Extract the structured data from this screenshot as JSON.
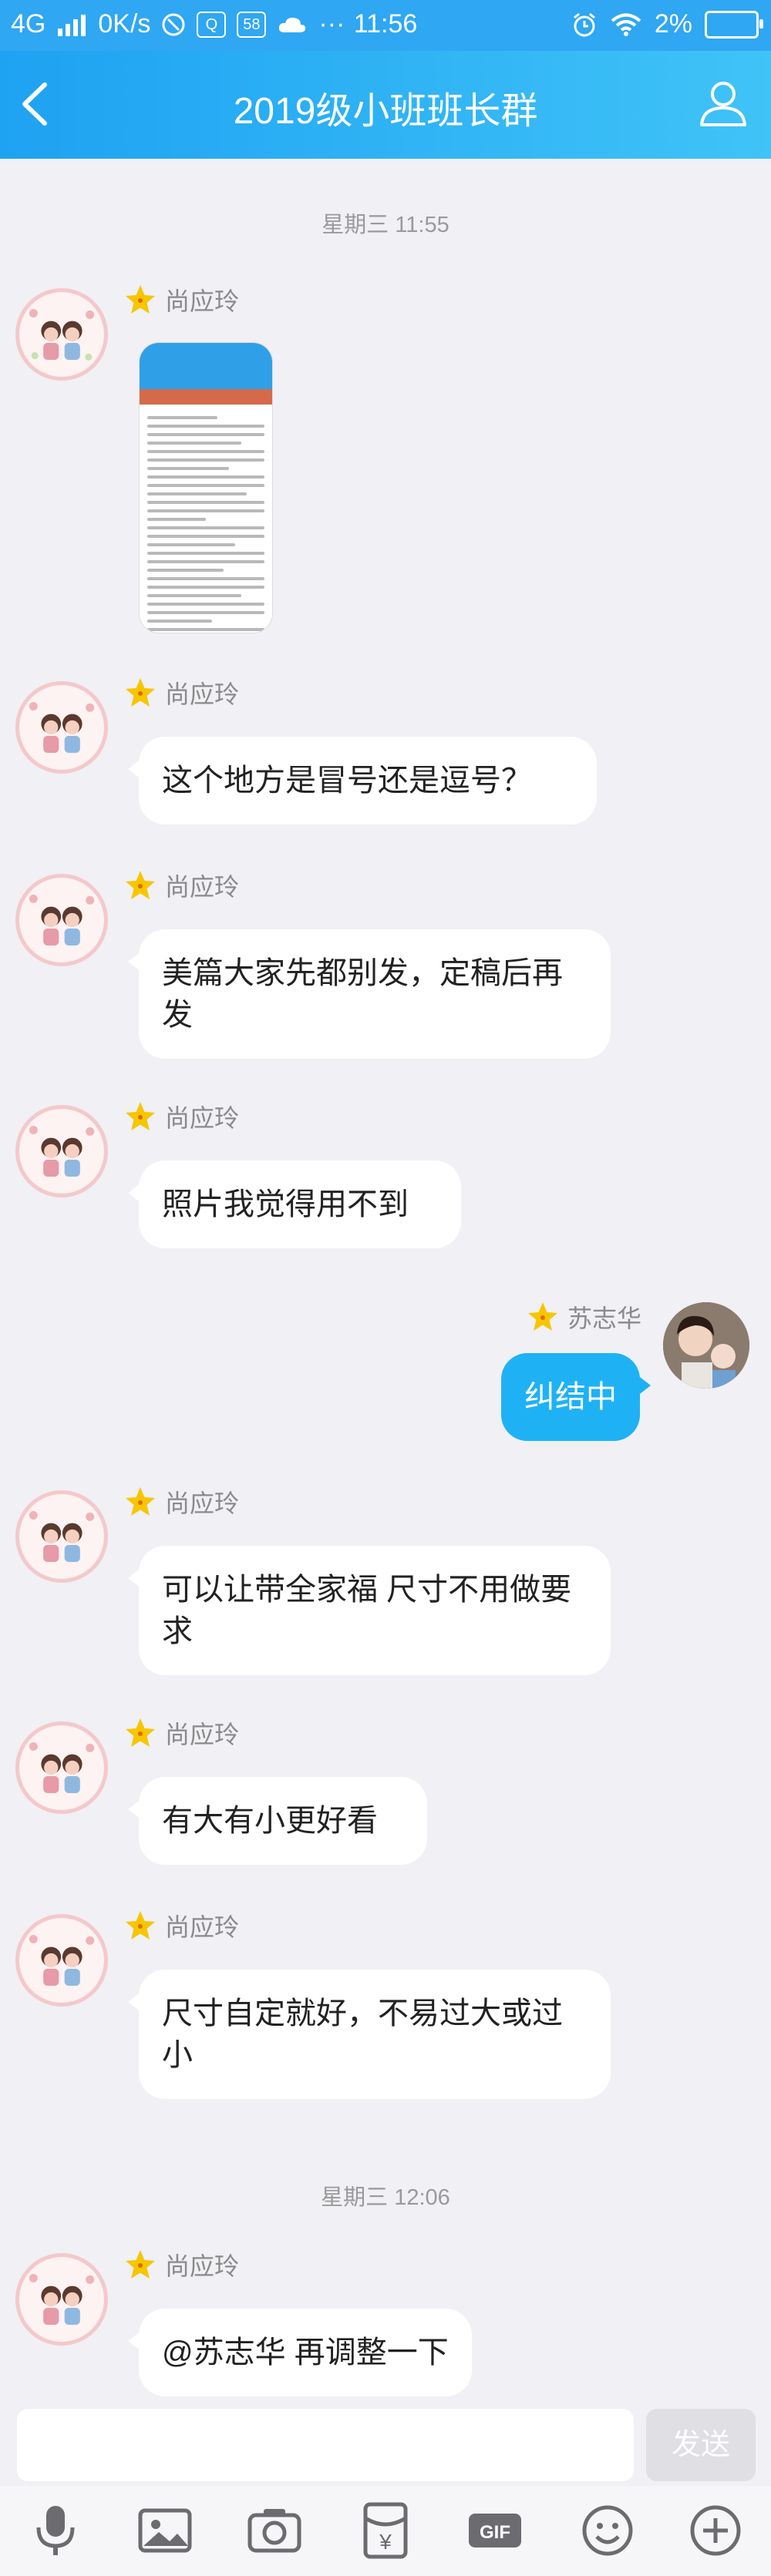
{
  "status_bar": {
    "network": "4G",
    "speed": "0K/s",
    "badge": "58",
    "more": "···",
    "time": "11:56",
    "battery": "2%"
  },
  "header": {
    "title": "2019级小班班长群"
  },
  "messages": [
    {
      "type": "time",
      "text": "星期三 11:55"
    },
    {
      "type": "image",
      "sender": "尚应玲"
    },
    {
      "type": "text",
      "sender": "尚应玲",
      "text": "这个地方是冒号还是逗号？"
    },
    {
      "type": "text",
      "sender": "尚应玲",
      "text": "美篇大家先都别发，定稿后再发"
    },
    {
      "type": "text",
      "sender": "尚应玲",
      "text": "照片我觉得用不到"
    },
    {
      "type": "text",
      "sender": "苏志华",
      "text": "纠结中",
      "self": true
    },
    {
      "type": "text",
      "sender": "尚应玲",
      "text": "可以让带全家福 尺寸不用做要求"
    },
    {
      "type": "text",
      "sender": "尚应玲",
      "text": "有大有小更好看"
    },
    {
      "type": "text",
      "sender": "尚应玲",
      "text": "尺寸自定就好，不易过大或过小"
    },
    {
      "type": "time",
      "text": "星期三 12:06"
    },
    {
      "type": "text",
      "sender": "尚应玲",
      "text": "@苏志华 再调整一下"
    }
  ],
  "input": {
    "value": "",
    "send_label": "发送"
  },
  "toolbar": {
    "items": [
      "mic-icon",
      "picture-icon",
      "camera-icon",
      "red-packet-icon",
      "gif-icon",
      "emoji-icon",
      "plus-icon"
    ],
    "red_packet_symbol": "¥",
    "gif_label": "GIF"
  },
  "colors": {
    "accent": "#1eb2f5",
    "title_bar": "#2fa7f2",
    "background": "#f0f0f5"
  }
}
